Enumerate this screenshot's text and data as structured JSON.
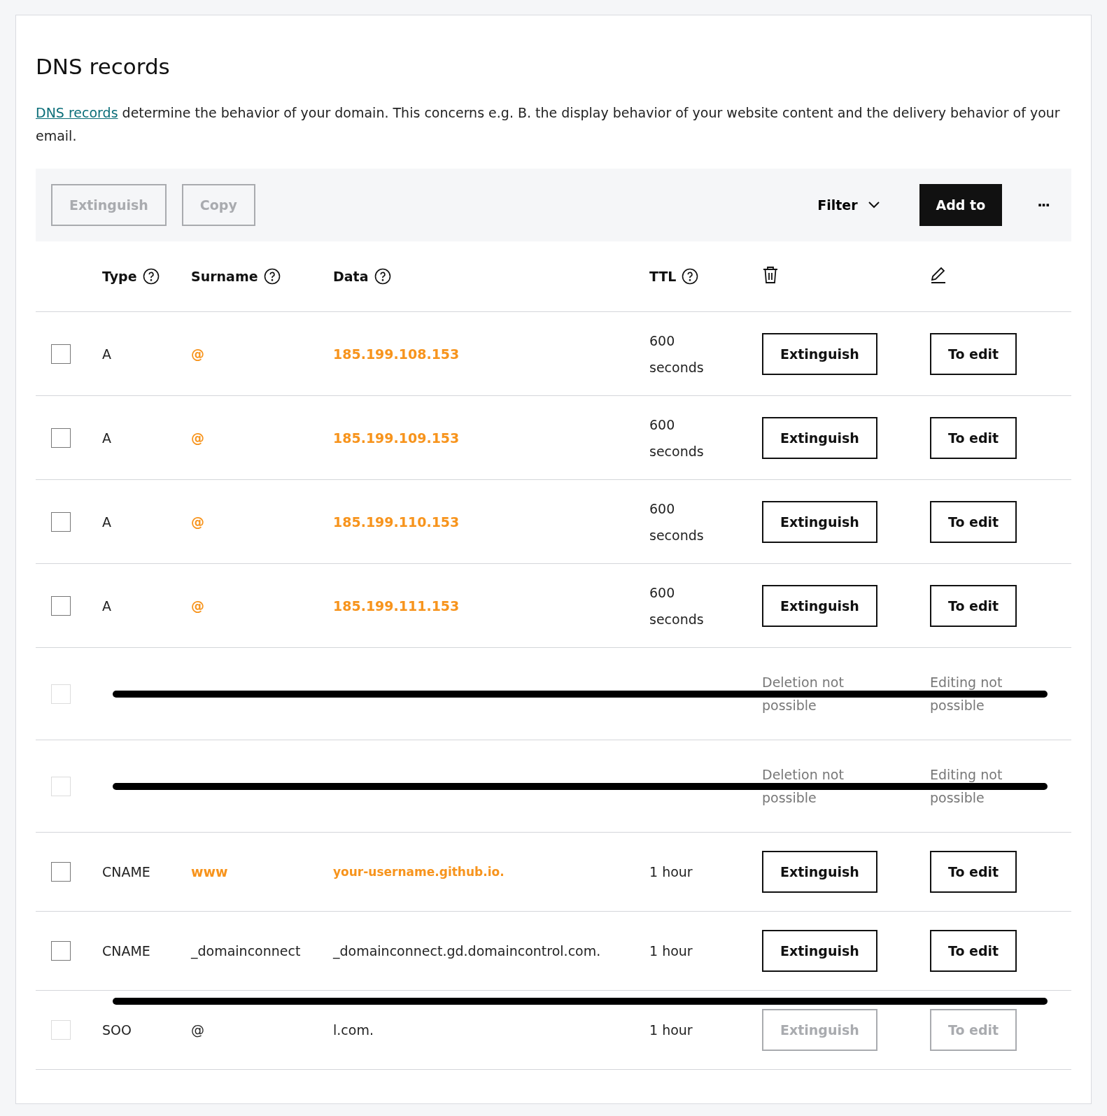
{
  "title": "DNS records",
  "intro": {
    "link": "DNS records",
    "text": " determine the behavior of your domain. This concerns e.g. B. the display behavior of your website content and the delivery behavior of your email."
  },
  "toolbar": {
    "left_buttons": [
      {
        "label": "Extinguish",
        "disabled": true
      },
      {
        "label": "Copy",
        "disabled": true
      }
    ],
    "filter": "Filter",
    "add": "Add to",
    "more": "···"
  },
  "columns": [
    {
      "label": "Type",
      "kind": "text"
    },
    {
      "label": "Surname",
      "kind": "text"
    },
    {
      "label": "Data",
      "kind": "text"
    },
    {
      "label": "TTL",
      "kind": "text"
    },
    {
      "kind": "delete"
    },
    {
      "kind": "edit"
    }
  ],
  "rows": [
    {
      "type": "A",
      "name": "@",
      "data": "185.199.108.153",
      "ttl": "600 seconds",
      "highlighted": true,
      "redacted": false,
      "checked": false,
      "delete": {
        "kind": "button",
        "label": "Extinguish",
        "disabled": false
      },
      "edit": {
        "kind": "button",
        "label": "To edit",
        "disabled": false
      }
    },
    {
      "type": "A",
      "name": "@",
      "data": "185.199.109.153",
      "ttl": "600 seconds",
      "highlighted": true,
      "redacted": false,
      "checked": false,
      "delete": {
        "kind": "button",
        "label": "Extinguish",
        "disabled": false
      },
      "edit": {
        "kind": "button",
        "label": "To edit",
        "disabled": false
      }
    },
    {
      "type": "A",
      "name": "@",
      "data": "185.199.110.153",
      "ttl": "600 seconds",
      "highlighted": true,
      "redacted": false,
      "checked": false,
      "delete": {
        "kind": "button",
        "label": "Extinguish",
        "disabled": false
      },
      "edit": {
        "kind": "button",
        "label": "To edit",
        "disabled": false
      }
    },
    {
      "type": "A",
      "name": "@",
      "data": "185.199.111.153",
      "ttl": "600 seconds",
      "highlighted": true,
      "redacted": false,
      "checked": false,
      "delete": {
        "kind": "button",
        "label": "Extinguish",
        "disabled": false
      },
      "edit": {
        "kind": "button",
        "label": "To edit",
        "disabled": false
      }
    },
    {
      "redacted": true,
      "checked": false,
      "delete": {
        "kind": "note",
        "label": "Deletion not possible"
      },
      "edit": {
        "kind": "note",
        "label": "Editing not possible"
      }
    },
    {
      "redacted": true,
      "checked": false,
      "delete": {
        "kind": "note",
        "label": "Deletion not possible"
      },
      "edit": {
        "kind": "note",
        "label": "Editing not possible"
      }
    },
    {
      "type": "CNAME",
      "name": "www",
      "data": "your-username.github.io.",
      "ttl": "1 hour",
      "highlighted": true,
      "redacted": false,
      "checked": false,
      "delete": {
        "kind": "button",
        "label": "Extinguish",
        "disabled": false
      },
      "edit": {
        "kind": "button",
        "label": "To edit",
        "disabled": false
      }
    },
    {
      "type": "CNAME",
      "name": "_domainconnect",
      "data": "_domainconnect.gd.domaincontrol.com.",
      "ttl": "1 hour",
      "highlighted": false,
      "redacted": false,
      "checked": false,
      "delete": {
        "kind": "button",
        "label": "Extinguish",
        "disabled": false
      },
      "edit": {
        "kind": "button",
        "label": "To edit",
        "disabled": false
      }
    },
    {
      "type": "SOO",
      "name": "@",
      "data": "l.com.",
      "ttl": "1 hour",
      "highlighted": false,
      "redacted": true,
      "checked": false,
      "delete": {
        "kind": "button",
        "label": "Extinguish",
        "disabled": true
      },
      "edit": {
        "kind": "button",
        "label": "To edit",
        "disabled": true
      }
    }
  ]
}
